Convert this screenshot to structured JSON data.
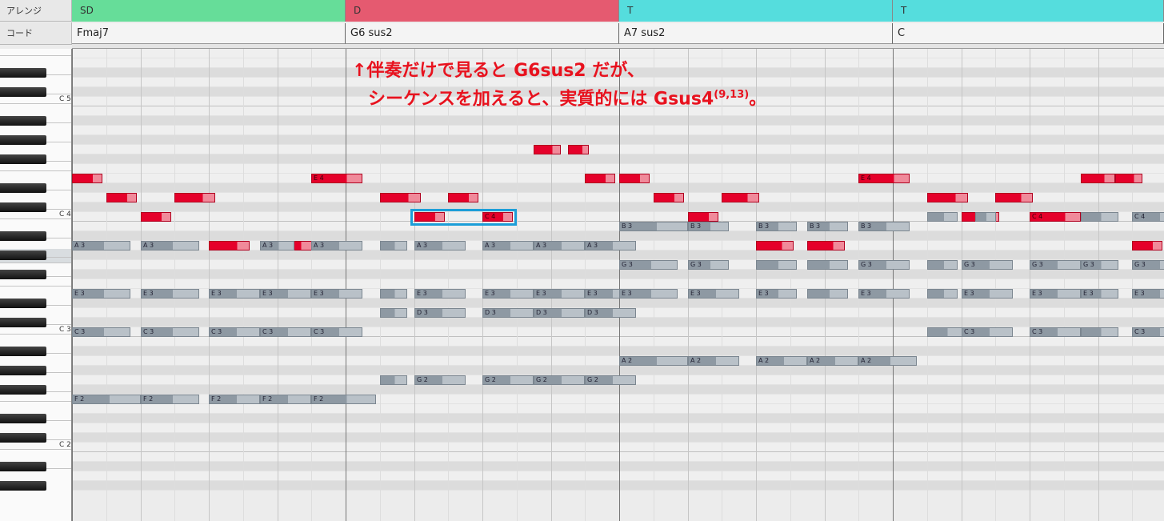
{
  "header": {
    "arrange_label": "アレンジ",
    "chord_label": "コード"
  },
  "arrangement": [
    {
      "label": "SD",
      "color": "#66dd99"
    },
    {
      "label": "D",
      "color": "#e55a70"
    },
    {
      "label": "T",
      "color": "#55dddd"
    },
    {
      "label": "T",
      "color": "#55dddd"
    }
  ],
  "chords": [
    "Fmaj7",
    "G6 sus2",
    "A7 sus2",
    "C"
  ],
  "keyboard": {
    "labels": [
      "C 5",
      "C 4",
      "C 3",
      "C 2"
    ]
  },
  "annotation": {
    "line1": "↑伴奏だけで見ると G6sus2 だが、",
    "line2": "シーケンスを加えると、実質的には Gsus4",
    "line2_sup": "(9,13)",
    "line2_end": "。"
  },
  "colors": {
    "melody": "#e5002a",
    "accompaniment": "#8e99a3",
    "highlight": "#1c9ed8",
    "annotation": "#e8121e"
  },
  "notes": [
    {
      "pitch": "E4",
      "beat": 0,
      "len": 0.45,
      "type": "mel",
      "label": ""
    },
    {
      "pitch": "D4",
      "beat": 0.5,
      "len": 0.45,
      "type": "mel",
      "label": ""
    },
    {
      "pitch": "C4",
      "beat": 1,
      "len": 0.45,
      "type": "mel",
      "label": ""
    },
    {
      "pitch": "D4",
      "beat": 1.5,
      "len": 0.6,
      "type": "mel",
      "label": ""
    },
    {
      "pitch": "E4",
      "beat": 3.5,
      "len": 0.75,
      "type": "mel",
      "label": "E 4"
    },
    {
      "pitch": "A3",
      "beat": 2,
      "len": 0.6,
      "type": "mel",
      "label": ""
    },
    {
      "pitch": "A3",
      "beat": 3,
      "len": 0.5,
      "type": "mel",
      "label": ""
    },
    {
      "pitch": "A3",
      "beat": 0,
      "len": 0.85,
      "type": "acc",
      "label": "A 3"
    },
    {
      "pitch": "A3",
      "beat": 1,
      "len": 0.85,
      "type": "acc",
      "label": "A 3"
    },
    {
      "pitch": "A3",
      "beat": 2.75,
      "len": 0.5,
      "type": "acc",
      "label": "A 3"
    },
    {
      "pitch": "A3",
      "beat": 3.5,
      "len": 0.75,
      "type": "acc",
      "label": "A 3"
    },
    {
      "pitch": "E3",
      "beat": 0,
      "len": 0.85,
      "type": "acc",
      "label": "E 3"
    },
    {
      "pitch": "E3",
      "beat": 1,
      "len": 0.85,
      "type": "acc",
      "label": "E 3"
    },
    {
      "pitch": "E3",
      "beat": 2,
      "len": 0.75,
      "type": "acc",
      "label": "E 3"
    },
    {
      "pitch": "E3",
      "beat": 2.75,
      "len": 0.75,
      "type": "acc",
      "label": "E 3"
    },
    {
      "pitch": "E3",
      "beat": 3.5,
      "len": 0.75,
      "type": "acc",
      "label": "E 3"
    },
    {
      "pitch": "C3",
      "beat": 0,
      "len": 0.85,
      "type": "acc",
      "label": "C 3"
    },
    {
      "pitch": "C3",
      "beat": 1,
      "len": 0.85,
      "type": "acc",
      "label": "C 3"
    },
    {
      "pitch": "C3",
      "beat": 2,
      "len": 0.75,
      "type": "acc",
      "label": "C 3"
    },
    {
      "pitch": "C3",
      "beat": 2.75,
      "len": 0.75,
      "type": "acc",
      "label": "C 3"
    },
    {
      "pitch": "C3",
      "beat": 3.5,
      "len": 0.75,
      "type": "acc",
      "label": "C 3"
    },
    {
      "pitch": "F2",
      "beat": 0,
      "len": 1.0,
      "type": "acc",
      "label": "F 2"
    },
    {
      "pitch": "F2",
      "beat": 1,
      "len": 0.85,
      "type": "acc",
      "label": "F 2"
    },
    {
      "pitch": "F2",
      "beat": 2,
      "len": 0.75,
      "type": "acc",
      "label": "F 2"
    },
    {
      "pitch": "F2",
      "beat": 2.75,
      "len": 0.75,
      "type": "acc",
      "label": "F 2"
    },
    {
      "pitch": "F2",
      "beat": 3.5,
      "len": 0.95,
      "type": "acc",
      "label": "F 2"
    },
    {
      "pitch": "D4",
      "beat": 4.5,
      "len": 0.6,
      "type": "mel",
      "label": ""
    },
    {
      "pitch": "C4",
      "beat": 5,
      "len": 0.45,
      "type": "mel",
      "label": ""
    },
    {
      "pitch": "D4",
      "beat": 5.5,
      "len": 0.45,
      "type": "mel",
      "label": ""
    },
    {
      "pitch": "C4",
      "beat": 6,
      "len": 0.45,
      "type": "mel",
      "label": "C 4"
    },
    {
      "pitch": "G4",
      "beat": 6.75,
      "len": 0.4,
      "type": "mel",
      "label": ""
    },
    {
      "pitch": "G4",
      "beat": 7.25,
      "len": 0.3,
      "type": "mel",
      "label": ""
    },
    {
      "pitch": "E4",
      "beat": 7.5,
      "len": 0.45,
      "type": "mel",
      "label": ""
    },
    {
      "pitch": "A3",
      "beat": 4.5,
      "len": 0.4,
      "type": "acc",
      "label": ""
    },
    {
      "pitch": "A3",
      "beat": 5,
      "len": 0.75,
      "type": "acc",
      "label": "A 3"
    },
    {
      "pitch": "A3",
      "beat": 6,
      "len": 0.75,
      "type": "acc",
      "label": "A 3"
    },
    {
      "pitch": "A3",
      "beat": 6.75,
      "len": 0.75,
      "type": "acc",
      "label": "A 3"
    },
    {
      "pitch": "A3",
      "beat": 7.5,
      "len": 0.75,
      "type": "acc",
      "label": "A 3"
    },
    {
      "pitch": "E3",
      "beat": 4.5,
      "len": 0.4,
      "type": "acc",
      "label": ""
    },
    {
      "pitch": "E3",
      "beat": 5,
      "len": 0.75,
      "type": "acc",
      "label": "E 3"
    },
    {
      "pitch": "E3",
      "beat": 6,
      "len": 0.75,
      "type": "acc",
      "label": "E 3"
    },
    {
      "pitch": "E3",
      "beat": 6.75,
      "len": 0.75,
      "type": "acc",
      "label": "E 3"
    },
    {
      "pitch": "E3",
      "beat": 7.5,
      "len": 0.75,
      "type": "acc",
      "label": "E 3"
    },
    {
      "pitch": "D3",
      "beat": 4.5,
      "len": 0.4,
      "type": "acc",
      "label": ""
    },
    {
      "pitch": "D3",
      "beat": 5,
      "len": 0.75,
      "type": "acc",
      "label": "D 3"
    },
    {
      "pitch": "D3",
      "beat": 6,
      "len": 0.75,
      "type": "acc",
      "label": "D 3"
    },
    {
      "pitch": "D3",
      "beat": 6.75,
      "len": 0.75,
      "type": "acc",
      "label": "D 3"
    },
    {
      "pitch": "D3",
      "beat": 7.5,
      "len": 0.75,
      "type": "acc",
      "label": "D 3"
    },
    {
      "pitch": "G2",
      "beat": 4.5,
      "len": 0.4,
      "type": "acc",
      "label": ""
    },
    {
      "pitch": "G2",
      "beat": 5,
      "len": 0.75,
      "type": "acc",
      "label": "G 2"
    },
    {
      "pitch": "G2",
      "beat": 6,
      "len": 0.75,
      "type": "acc",
      "label": "G 2"
    },
    {
      "pitch": "G2",
      "beat": 6.75,
      "len": 0.75,
      "type": "acc",
      "label": "G 2"
    },
    {
      "pitch": "G2",
      "beat": 7.5,
      "len": 0.75,
      "type": "acc",
      "label": "G 2"
    },
    {
      "pitch": "E4",
      "beat": 8,
      "len": 0.45,
      "type": "mel",
      "label": ""
    },
    {
      "pitch": "D4",
      "beat": 8.5,
      "len": 0.45,
      "type": "mel",
      "label": ""
    },
    {
      "pitch": "C4",
      "beat": 9,
      "len": 0.45,
      "type": "mel",
      "label": ""
    },
    {
      "pitch": "D4",
      "beat": 9.5,
      "len": 0.55,
      "type": "mel",
      "label": ""
    },
    {
      "pitch": "E4",
      "beat": 11.5,
      "len": 0.75,
      "type": "mel",
      "label": "E 4"
    },
    {
      "pitch": "A3",
      "beat": 10,
      "len": 0.55,
      "type": "mel",
      "label": ""
    },
    {
      "pitch": "A3",
      "beat": 10.75,
      "len": 0.55,
      "type": "mel",
      "label": ""
    },
    {
      "pitch": "B3",
      "beat": 8,
      "len": 1.0,
      "type": "acc",
      "label": "B 3"
    },
    {
      "pitch": "B3",
      "beat": 9,
      "len": 0.6,
      "type": "acc",
      "label": "B 3"
    },
    {
      "pitch": "B3",
      "beat": 10,
      "len": 0.6,
      "type": "acc",
      "label": "B 3"
    },
    {
      "pitch": "B3",
      "beat": 10.75,
      "len": 0.6,
      "type": "acc",
      "label": "B 3"
    },
    {
      "pitch": "B3",
      "beat": 11.5,
      "len": 0.75,
      "type": "acc",
      "label": "B 3"
    },
    {
      "pitch": "G3",
      "beat": 8,
      "len": 0.85,
      "type": "acc",
      "label": "G 3"
    },
    {
      "pitch": "G3",
      "beat": 9,
      "len": 0.6,
      "type": "acc",
      "label": "G 3"
    },
    {
      "pitch": "G3",
      "beat": 10,
      "len": 0.6,
      "type": "acc",
      "label": ""
    },
    {
      "pitch": "G3",
      "beat": 10.75,
      "len": 0.6,
      "type": "acc",
      "label": ""
    },
    {
      "pitch": "G3",
      "beat": 11.5,
      "len": 0.75,
      "type": "acc",
      "label": "G 3"
    },
    {
      "pitch": "E3",
      "beat": 8,
      "len": 0.85,
      "type": "acc",
      "label": "E 3"
    },
    {
      "pitch": "E3",
      "beat": 9,
      "len": 0.75,
      "type": "acc",
      "label": "E 3"
    },
    {
      "pitch": "E3",
      "beat": 10,
      "len": 0.6,
      "type": "acc",
      "label": "E 3"
    },
    {
      "pitch": "E3",
      "beat": 10.75,
      "len": 0.6,
      "type": "acc",
      "label": ""
    },
    {
      "pitch": "E3",
      "beat": 11.5,
      "len": 0.75,
      "type": "acc",
      "label": "E 3"
    },
    {
      "pitch": "A2",
      "beat": 8,
      "len": 1.0,
      "type": "acc",
      "label": "A 2"
    },
    {
      "pitch": "A2",
      "beat": 9,
      "len": 0.75,
      "type": "acc",
      "label": "A 2"
    },
    {
      "pitch": "A2",
      "beat": 10,
      "len": 0.75,
      "type": "acc",
      "label": "A 2"
    },
    {
      "pitch": "A2",
      "beat": 10.75,
      "len": 0.75,
      "type": "acc",
      "label": "A 2"
    },
    {
      "pitch": "A2",
      "beat": 11.5,
      "len": 0.85,
      "type": "acc",
      "label": "A 2"
    },
    {
      "pitch": "D4",
      "beat": 12.5,
      "len": 0.6,
      "type": "mel",
      "label": ""
    },
    {
      "pitch": "C4",
      "beat": 13,
      "len": 0.55,
      "type": "mel",
      "label": ""
    },
    {
      "pitch": "D4",
      "beat": 13.5,
      "len": 0.55,
      "type": "mel",
      "label": ""
    },
    {
      "pitch": "C4",
      "beat": 14,
      "len": 0.75,
      "type": "mel",
      "label": "C 4"
    },
    {
      "pitch": "E4",
      "beat": 14.75,
      "len": 0.5,
      "type": "mel",
      "label": ""
    },
    {
      "pitch": "E4",
      "beat": 15.25,
      "len": 0.4,
      "type": "mel",
      "label": ""
    },
    {
      "pitch": "A3",
      "beat": 11.0,
      "len": 0.0,
      "type": "acc",
      "label": ""
    },
    {
      "pitch": "A3",
      "beat": 15.5,
      "len": 0.45,
      "type": "mel",
      "label": ""
    },
    {
      "pitch": "C4",
      "beat": 12.5,
      "len": 0.45,
      "type": "acc",
      "label": ""
    },
    {
      "pitch": "C4",
      "beat": 13.2,
      "len": 0.3,
      "type": "acc",
      "label": ""
    },
    {
      "pitch": "C4",
      "beat": 14.75,
      "len": 0.55,
      "type": "acc",
      "label": ""
    },
    {
      "pitch": "C4",
      "beat": 15.5,
      "len": 0.75,
      "type": "acc",
      "label": "C 4"
    },
    {
      "pitch": "G3",
      "beat": 12.5,
      "len": 0.45,
      "type": "acc",
      "label": ""
    },
    {
      "pitch": "G3",
      "beat": 13,
      "len": 0.75,
      "type": "acc",
      "label": "G 3"
    },
    {
      "pitch": "G3",
      "beat": 14,
      "len": 0.75,
      "type": "acc",
      "label": "G 3"
    },
    {
      "pitch": "G3",
      "beat": 14.75,
      "len": 0.55,
      "type": "acc",
      "label": "G 3"
    },
    {
      "pitch": "G3",
      "beat": 15.5,
      "len": 0.75,
      "type": "acc",
      "label": "G 3"
    },
    {
      "pitch": "E3",
      "beat": 12.5,
      "len": 0.45,
      "type": "acc",
      "label": ""
    },
    {
      "pitch": "E3",
      "beat": 13,
      "len": 0.75,
      "type": "acc",
      "label": "E 3"
    },
    {
      "pitch": "E3",
      "beat": 14,
      "len": 0.75,
      "type": "acc",
      "label": "E 3"
    },
    {
      "pitch": "E3",
      "beat": 14.75,
      "len": 0.55,
      "type": "acc",
      "label": "E 3"
    },
    {
      "pitch": "E3",
      "beat": 15.5,
      "len": 0.75,
      "type": "acc",
      "label": "E 3"
    },
    {
      "pitch": "C3",
      "beat": 12.5,
      "len": 0.55,
      "type": "acc",
      "label": ""
    },
    {
      "pitch": "C3",
      "beat": 13,
      "len": 0.75,
      "type": "acc",
      "label": "C 3"
    },
    {
      "pitch": "C3",
      "beat": 14,
      "len": 0.75,
      "type": "acc",
      "label": "C 3"
    },
    {
      "pitch": "C3",
      "beat": 14.75,
      "len": 0.55,
      "type": "acc",
      "label": ""
    },
    {
      "pitch": "C3",
      "beat": 15.5,
      "len": 0.75,
      "type": "acc",
      "label": "C 3"
    }
  ],
  "highlight": {
    "pitch": "C4",
    "beat_start": 4.95,
    "beat_end": 6.5
  }
}
